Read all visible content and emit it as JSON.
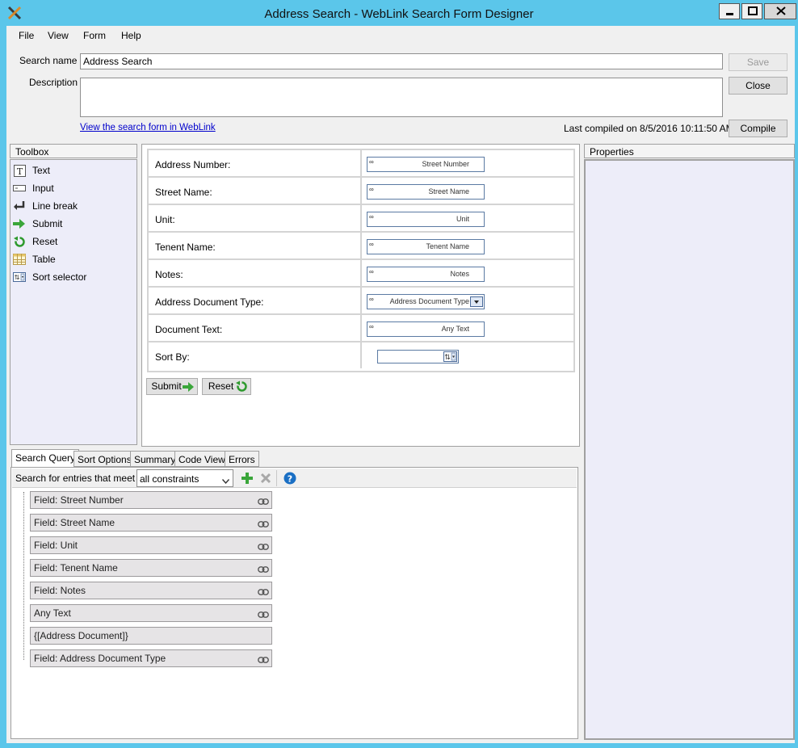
{
  "window": {
    "title": "Address Search - WebLink Search Form Designer",
    "app_icon": "tools-icon"
  },
  "menu": [
    "File",
    "View",
    "Form",
    "Help"
  ],
  "header": {
    "search_name_label": "Search name",
    "search_name_value": "Address Search",
    "description_label": "Description",
    "description_value": "",
    "view_link": "View the search form in WebLink",
    "last_compiled": "Last compiled on 8/5/2016 10:11:50 AM",
    "save_label": "Save",
    "close_label": "Close",
    "compile_label": "Compile"
  },
  "toolbox": {
    "title": "Toolbox",
    "items": [
      {
        "label": "Text",
        "icon": "text-icon"
      },
      {
        "label": "Input",
        "icon": "input-icon"
      },
      {
        "label": "Line break",
        "icon": "line-break-icon"
      },
      {
        "label": "Submit",
        "icon": "submit-arrow-icon"
      },
      {
        "label": "Reset",
        "icon": "reset-icon"
      },
      {
        "label": "Table",
        "icon": "table-icon"
      },
      {
        "label": "Sort selector",
        "icon": "sort-selector-icon"
      }
    ]
  },
  "form": {
    "rows": [
      {
        "label": "Address Number:",
        "field": "Street Number",
        "kind": "input"
      },
      {
        "label": "Street Name:",
        "field": "Street Name",
        "kind": "input"
      },
      {
        "label": "Unit:",
        "field": "Unit",
        "kind": "input"
      },
      {
        "label": "Tenent Name:",
        "field": "Tenent Name",
        "kind": "input"
      },
      {
        "label": "Notes:",
        "field": "Notes",
        "kind": "input"
      },
      {
        "label": "Address Document Type:",
        "field": "Address Document Type",
        "kind": "dropdown"
      },
      {
        "label": "Document Text:",
        "field": "Any Text",
        "kind": "input"
      },
      {
        "label": "Sort By:",
        "field": "",
        "kind": "sort"
      }
    ],
    "submit_label": "Submit",
    "reset_label": "Reset"
  },
  "properties": {
    "title": "Properties"
  },
  "tabs": [
    {
      "label": "Search Query",
      "active": true
    },
    {
      "label": "Sort Options",
      "active": false
    },
    {
      "label": "Summary",
      "active": false
    },
    {
      "label": "Code View",
      "active": false
    },
    {
      "label": "Errors",
      "active": false
    }
  ],
  "query": {
    "match_label": "Search for entries that meet",
    "match_value": "all constraints",
    "fields": [
      {
        "label": "Field: Street Number",
        "linked": true
      },
      {
        "label": "Field: Street Name",
        "linked": true
      },
      {
        "label": "Field: Unit",
        "linked": true
      },
      {
        "label": "Field: Tenent Name",
        "linked": true
      },
      {
        "label": "Field: Notes",
        "linked": true
      },
      {
        "label": "Any Text",
        "linked": true
      },
      {
        "label": "{[Address Document]}",
        "linked": false
      },
      {
        "label": "Field: Address Document Type",
        "linked": true
      }
    ]
  },
  "colors": {
    "titlebar": "#5bc6ea",
    "link": "#0000cc",
    "pane_bg": "#ededf9",
    "add_green": "#3aa63a",
    "help_blue": "#1a6fc4"
  }
}
